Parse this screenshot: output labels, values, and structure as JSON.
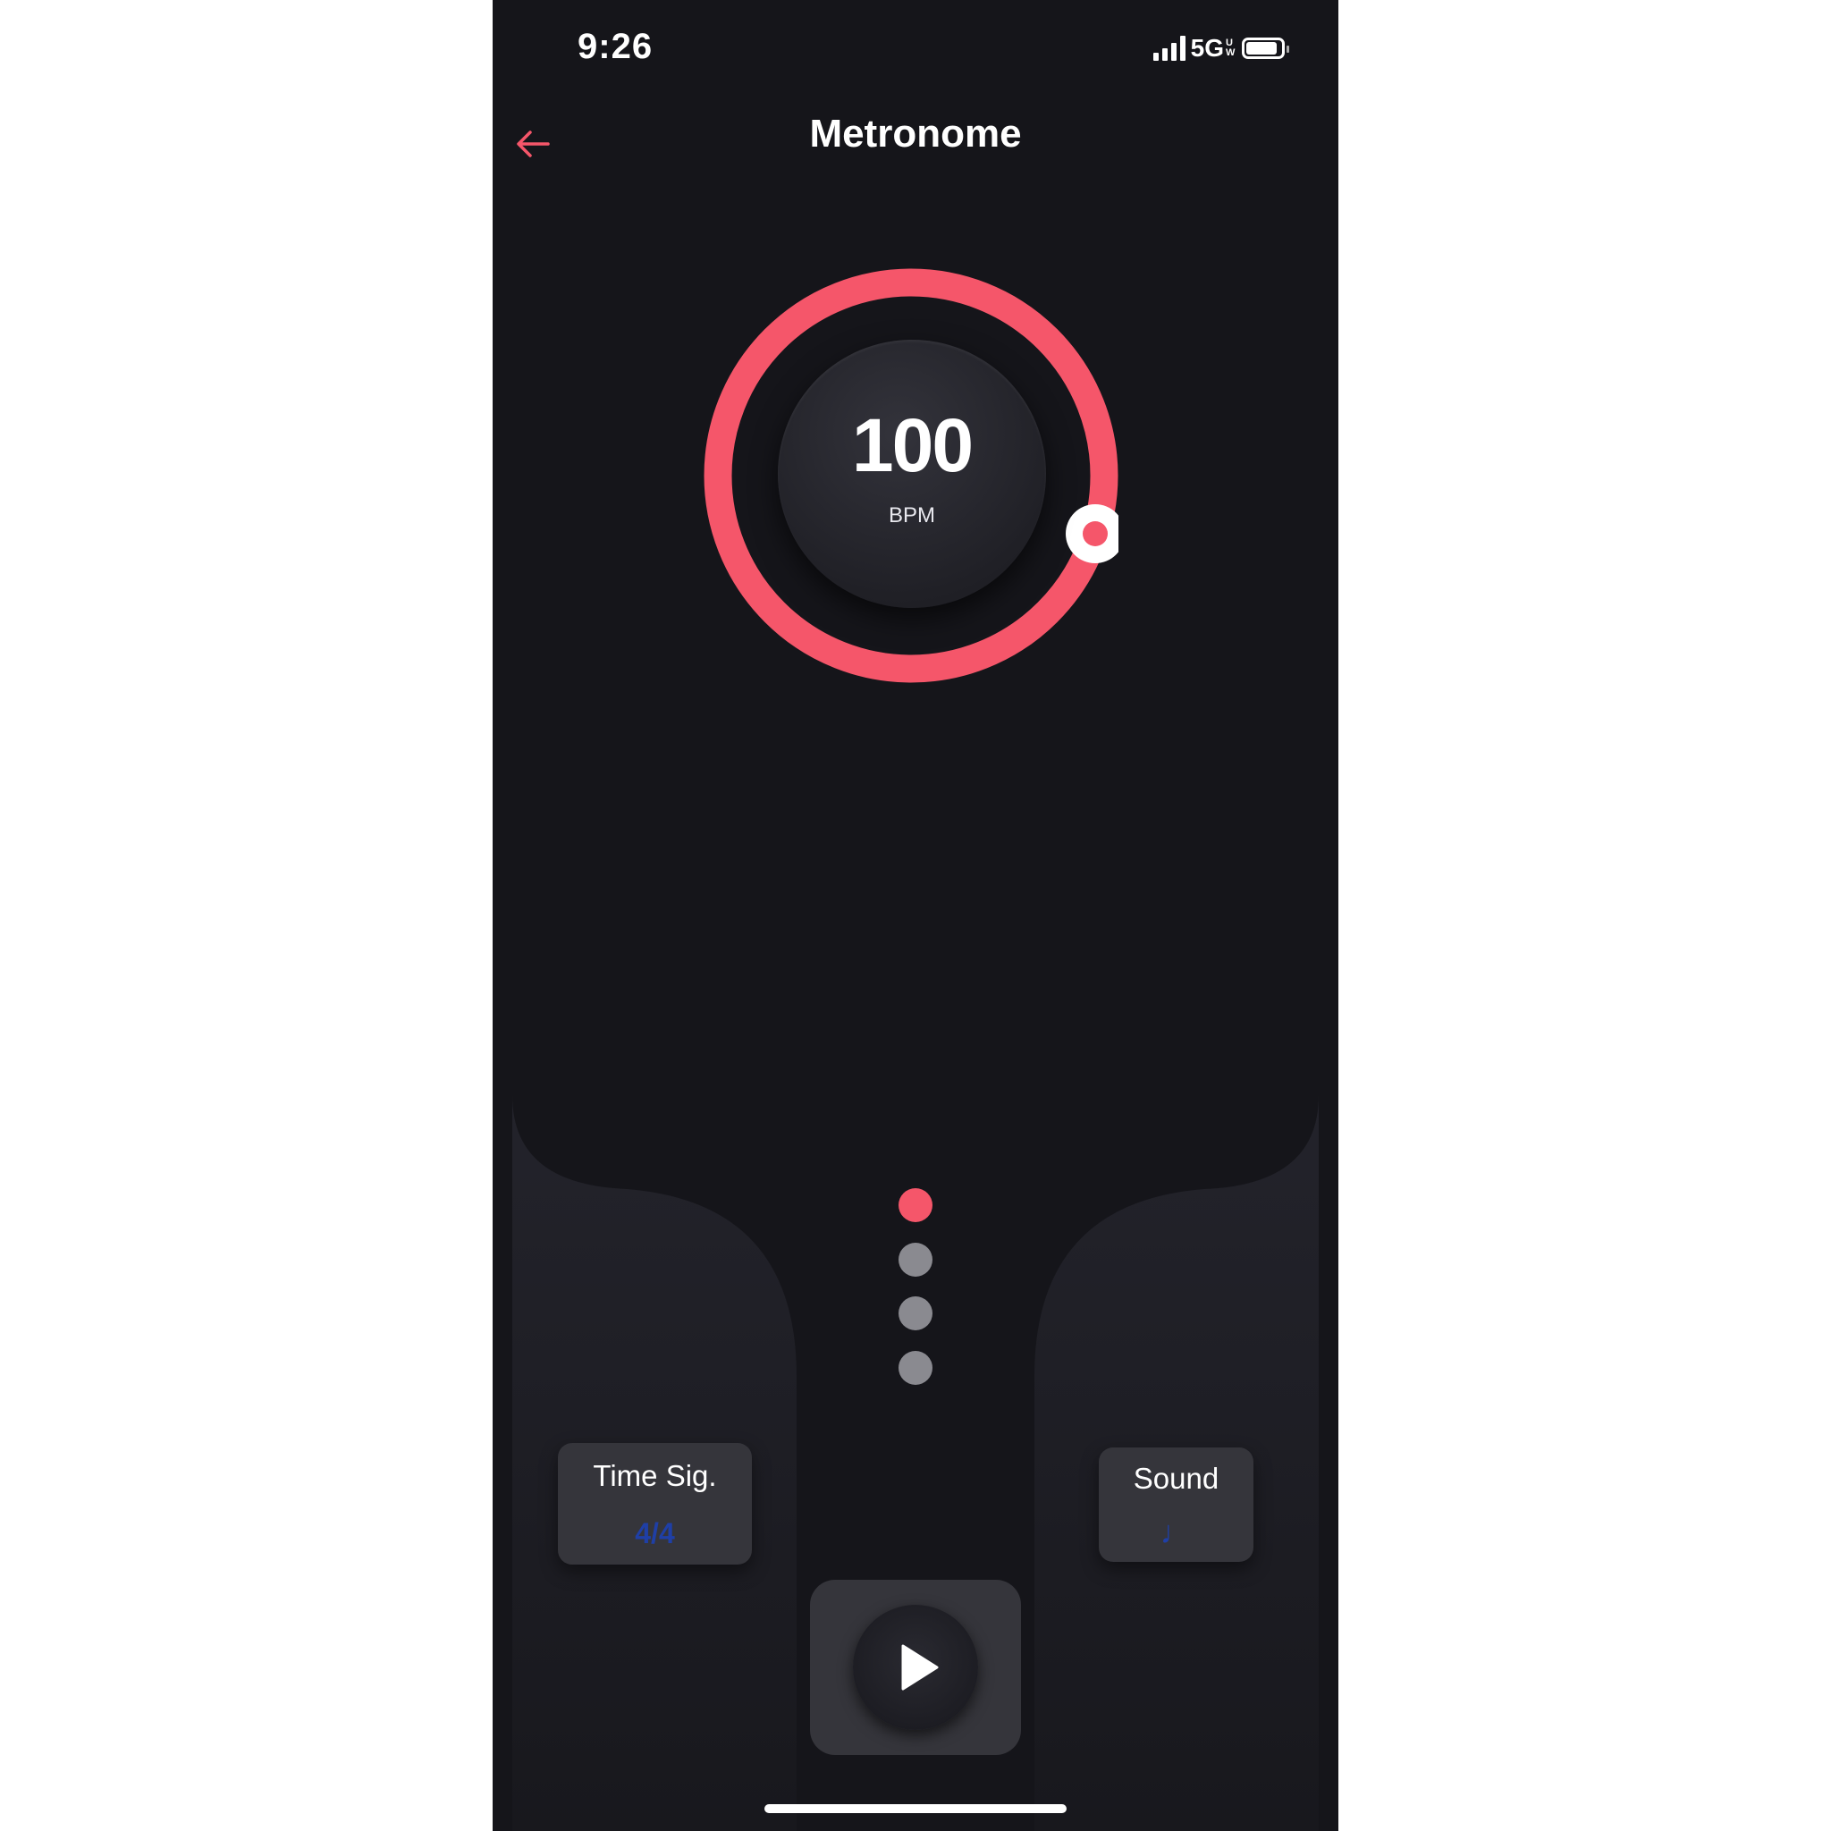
{
  "status_bar": {
    "time": "9:26",
    "network": "5G",
    "network_suffix": "UW",
    "signal_bars": 4,
    "battery_level": 0.9
  },
  "header": {
    "back_icon": "arrow-left-icon",
    "title": "Metronome"
  },
  "tempo": {
    "value": "100",
    "unit": "BPM"
  },
  "beats": {
    "count": 4,
    "active_index": 0,
    "active_color": "#f5566a",
    "inactive_color": "#8a8a90"
  },
  "controls": {
    "time_signature": {
      "label": "Time Sig.",
      "value": "4/4"
    },
    "sound": {
      "label": "Sound",
      "value": "♩"
    },
    "play_icon": "play-icon"
  },
  "colors": {
    "accent": "#f5566a",
    "background": "#15151a",
    "panel": "#35353b",
    "value_blue": "#1f3fa6"
  }
}
